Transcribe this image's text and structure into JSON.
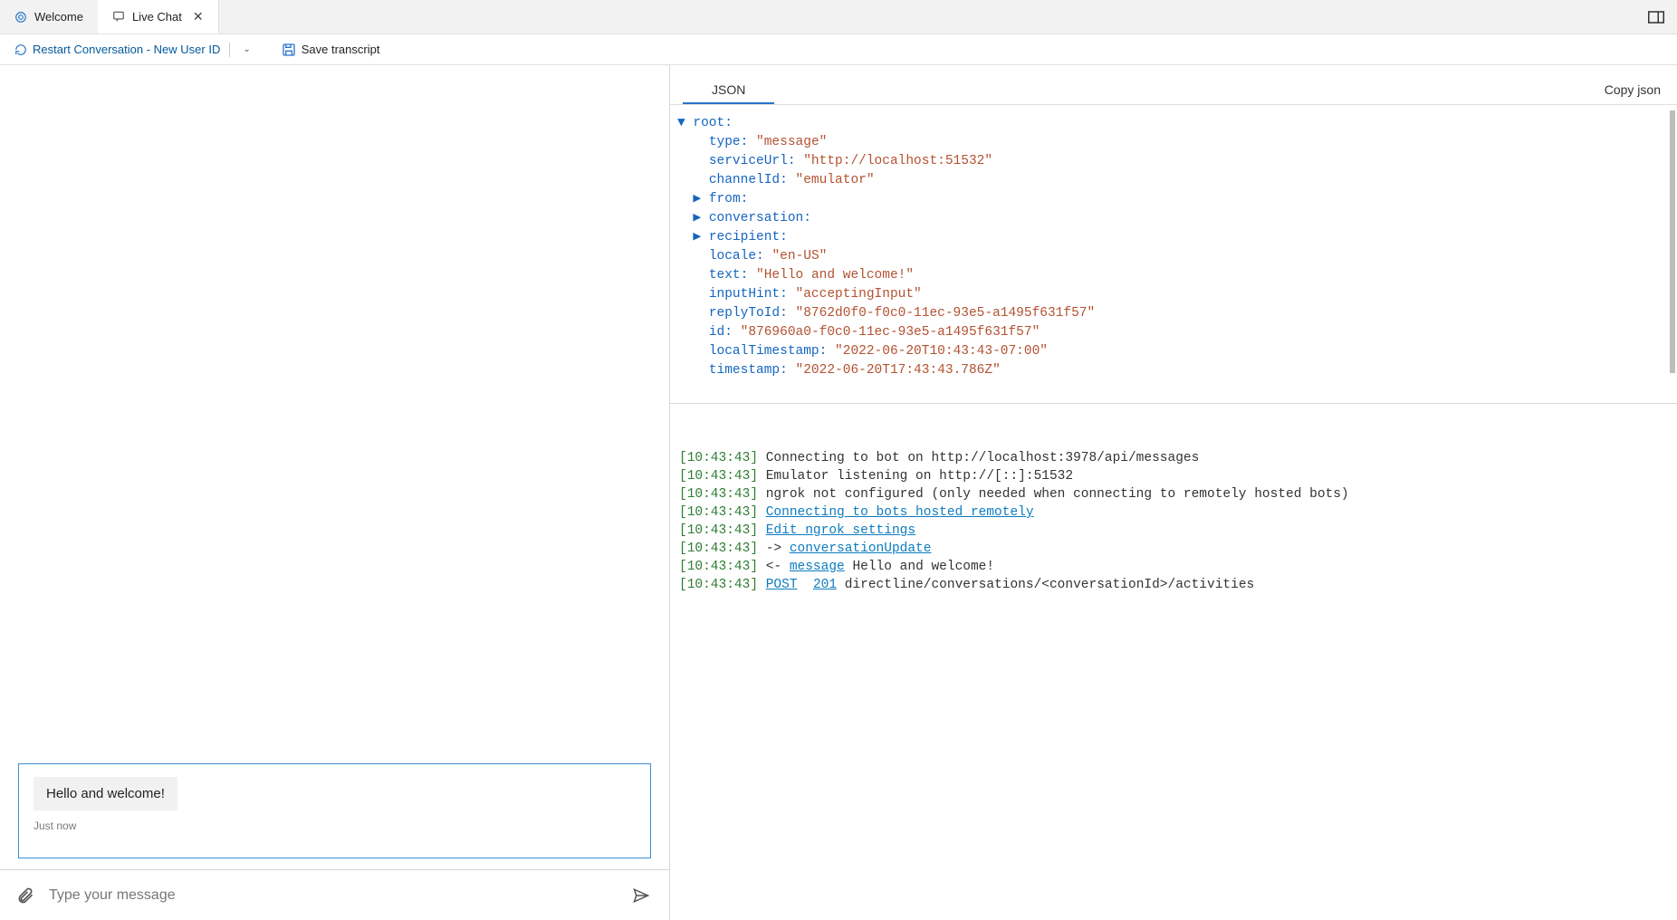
{
  "tabs": {
    "welcome": "Welcome",
    "livechat": "Live Chat"
  },
  "toolbar": {
    "restart": "Restart Conversation - New User ID",
    "save": "Save transcript"
  },
  "chat": {
    "bot_message": "Hello and welcome!",
    "timestamp": "Just now",
    "placeholder": "Type your message"
  },
  "right": {
    "json_tab": "JSON",
    "copy": "Copy json"
  },
  "json_tree": {
    "root": "root:",
    "type_k": "type:",
    "type_v": "\"message\"",
    "serviceUrl_k": "serviceUrl:",
    "serviceUrl_v": "\"http://localhost:51532\"",
    "channelId_k": "channelId:",
    "channelId_v": "\"emulator\"",
    "from_k": "from:",
    "conversation_k": "conversation:",
    "recipient_k": "recipient:",
    "locale_k": "locale:",
    "locale_v": "\"en-US\"",
    "text_k": "text:",
    "text_v": "\"Hello and welcome!\"",
    "inputHint_k": "inputHint:",
    "inputHint_v": "\"acceptingInput\"",
    "replyToId_k": "replyToId:",
    "replyToId_v": "\"8762d0f0-f0c0-11ec-93e5-a1495f631f57\"",
    "id_k": "id:",
    "id_v": "\"876960a0-f0c0-11ec-93e5-a1495f631f57\"",
    "localTimestamp_k": "localTimestamp:",
    "localTimestamp_v": "\"2022-06-20T10:43:43-07:00\"",
    "timestamp_k": "timestamp:",
    "timestamp_v": "\"2022-06-20T17:43:43.786Z\""
  },
  "log": {
    "ts": "[10:43:43]",
    "l1": " Connecting to bot on http://localhost:3978/api/messages",
    "l2": " Emulator listening on http://[::]:51532",
    "l3": " ngrok not configured (only needed when connecting to remotely hosted bots)",
    "l4_link": "Connecting to bots hosted remotely",
    "l5_link": "Edit ngrok settings",
    "l6_arrow": " -> ",
    "l6_link": "conversationUpdate",
    "l7_arrow": " <- ",
    "l7_link": "message",
    "l7_text": " Hello and welcome!",
    "l8_post": "POST",
    "l8_code": "201",
    "l8_text": " directline/conversations/<conversationId>/activities"
  }
}
